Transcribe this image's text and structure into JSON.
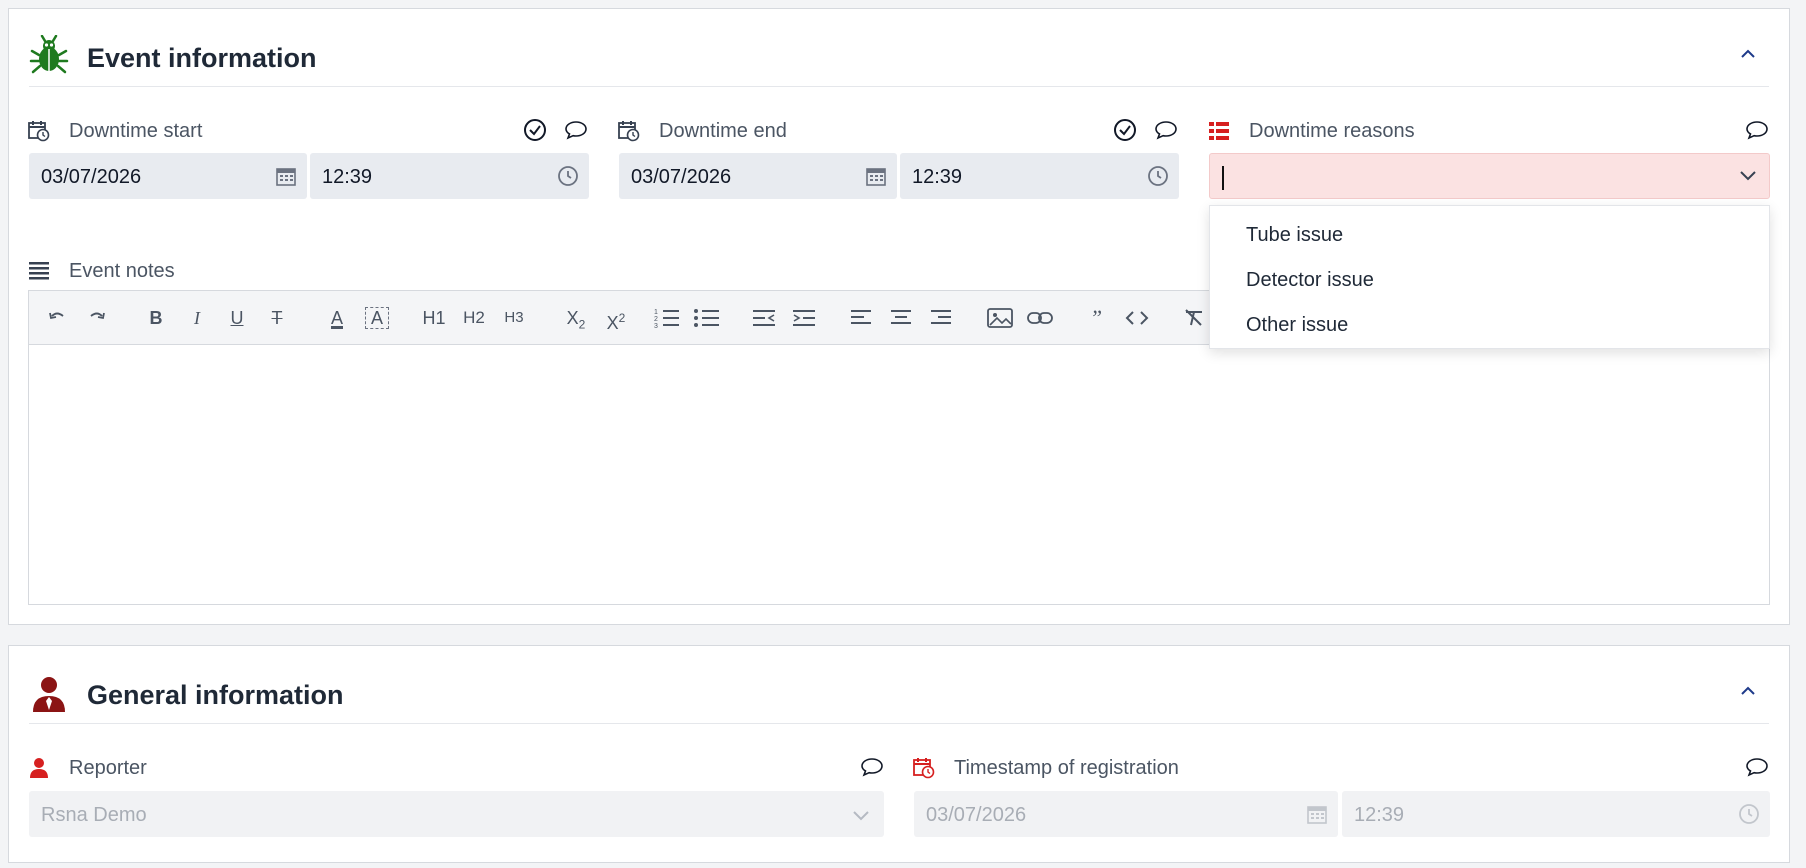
{
  "event_card": {
    "title": "Event information",
    "downtime_start": {
      "label": "Downtime start",
      "date": "03/07/2026",
      "time": "12:39"
    },
    "downtime_end": {
      "label": "Downtime end",
      "date": "03/07/2026",
      "time": "12:39"
    },
    "downtime_reasons": {
      "label": "Downtime reasons",
      "value": "",
      "options": [
        "Tube issue",
        "Detector issue",
        "Other issue"
      ]
    },
    "event_notes": {
      "label": "Event notes",
      "toolbar": {
        "h1": "H1",
        "h2": "H2",
        "h3": "H3",
        "subscript": "X",
        "subscript_sub": "2",
        "superscript": "X",
        "superscript_sup": "2",
        "bold": "B",
        "italic": "I",
        "underline": "U",
        "strike": "T",
        "font_color": "A",
        "highlight": "A",
        "quote": "”"
      }
    }
  },
  "general_card": {
    "title": "General information",
    "reporter": {
      "label": "Reporter",
      "value": "Rsna Demo"
    },
    "timestamp": {
      "label": "Timestamp of registration",
      "date": "03/07/2026",
      "time": "12:39"
    }
  },
  "colors": {
    "accent_green": "#1f7a1f",
    "accent_red": "#d62020",
    "dark_red": "#8b1414",
    "input_bg": "#e8ebf0",
    "invalid_bg": "#fbe2e2"
  }
}
